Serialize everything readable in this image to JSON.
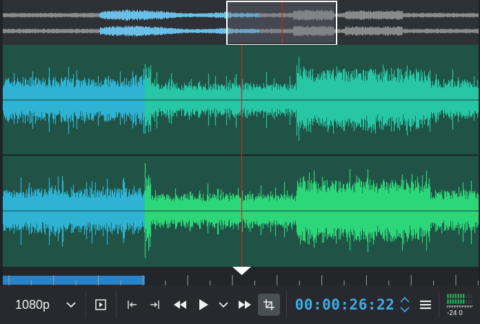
{
  "toolbar": {
    "resolution": "1080p",
    "timecode": "00:00:26:22"
  },
  "meter": {
    "scale_low": "-24",
    "scale_high": "0"
  },
  "icons": {
    "resolution_dropdown": "chevron-down-icon",
    "preview_zone": "play-in-frame-icon",
    "set_in": "set-zone-in-icon",
    "set_out": "set-zone-out-icon",
    "rewind": "rewind-icon",
    "play": "play-icon",
    "play_options": "chevron-down-icon",
    "forward": "fast-forward-icon",
    "crop": "crop-icon",
    "timecode_stepper": "up-down-icon",
    "menu": "hamburger-menu-icon"
  },
  "colors": {
    "accent": "#3daee9",
    "zone_blue": "#2fb3d4",
    "wave_teal": "#27c6a4",
    "wave_green": "#2cd779",
    "track_bg": "#205346",
    "overview_wave": "#8a8a8a",
    "overview_highlight": "#6bbfe6",
    "playhead": "#c62828",
    "meter_green": "#27ae60"
  }
}
